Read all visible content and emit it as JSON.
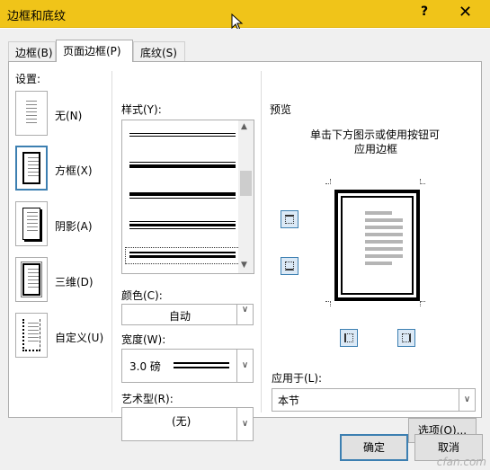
{
  "window": {
    "title": "边框和底纹",
    "help_label": "?",
    "close_label": "✕"
  },
  "tabs": [
    {
      "label": "边框(B)"
    },
    {
      "label": "页面边框(P)"
    },
    {
      "label": "底纹(S)"
    }
  ],
  "settings": {
    "header": "设置:",
    "items": [
      {
        "label": "无(N)"
      },
      {
        "label": "方框(X)"
      },
      {
        "label": "阴影(A)"
      },
      {
        "label": "三维(D)"
      },
      {
        "label": "自定义(U)"
      }
    ]
  },
  "style": {
    "header": "样式(Y):"
  },
  "color": {
    "label": "颜色(C):",
    "value": "自动"
  },
  "width": {
    "label": "宽度(W):",
    "value": "3.0 磅"
  },
  "art": {
    "label": "艺术型(R):",
    "value": "(无)"
  },
  "preview": {
    "header": "预览",
    "hint_line1": "单击下方图示或使用按钮可",
    "hint_line2": "应用边框"
  },
  "apply_to": {
    "label": "应用于(L):",
    "value": "本节"
  },
  "buttons": {
    "options": "选项(O)...",
    "ok": "确定",
    "cancel": "取消"
  },
  "watermark": "cfan.com"
}
